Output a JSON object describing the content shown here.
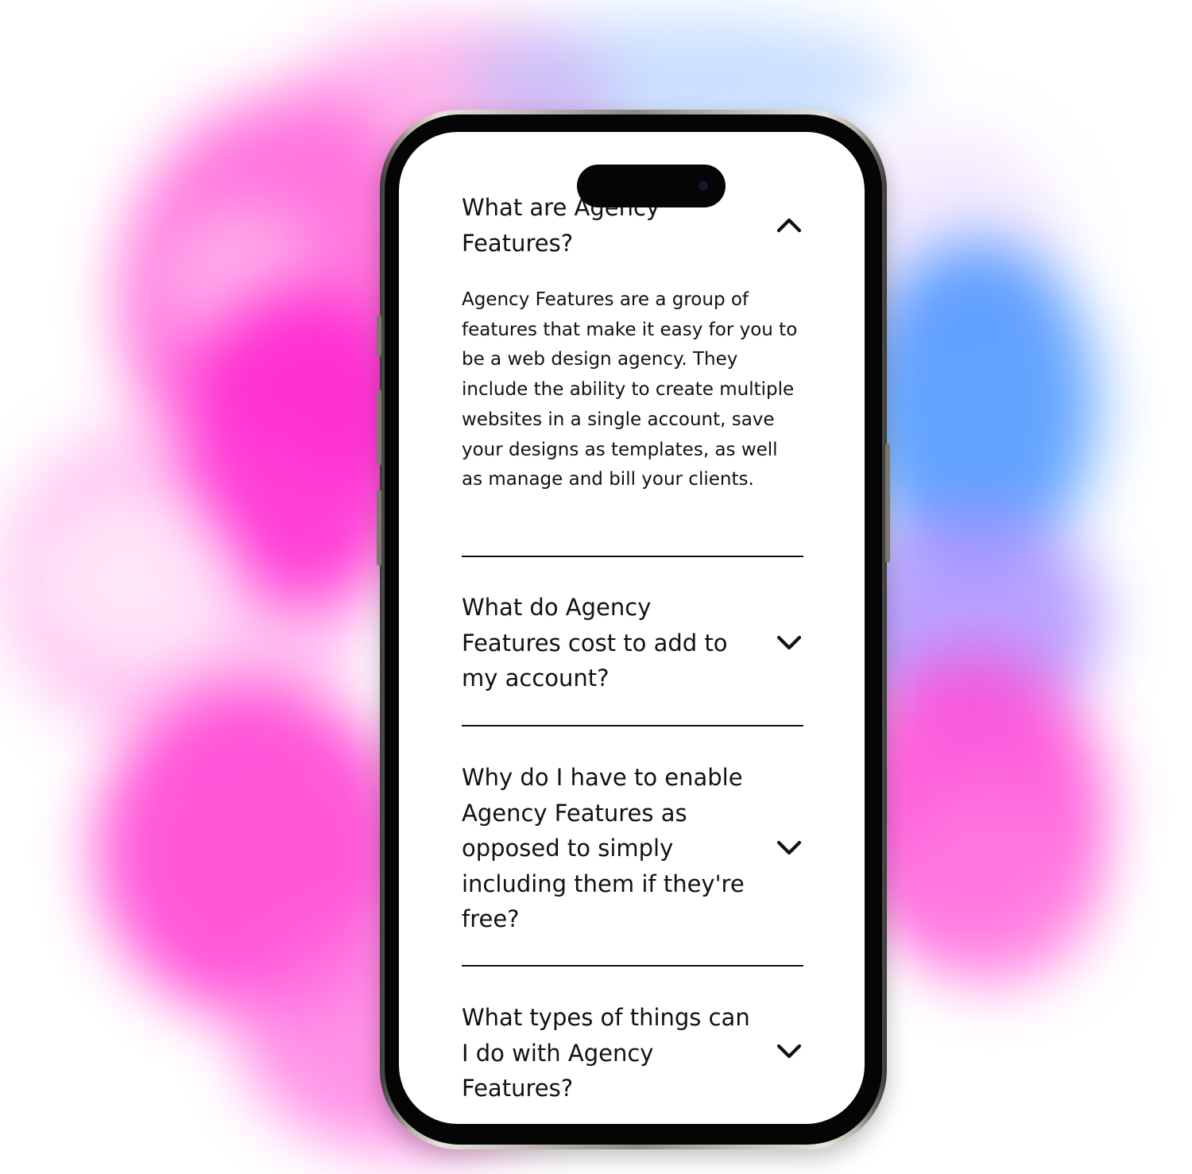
{
  "faq": {
    "items": [
      {
        "question": "What are Agency Features?",
        "expanded": true,
        "toggle_icon": "chevron-up-icon",
        "answer": "Agency Features are a group of features that make it easy for you to be a web design agency. They include the ability to create multiple websites in a single account, save your designs as templates, as well as manage and bill your clients."
      },
      {
        "question": "What do Agency Features cost to add to my account?",
        "expanded": false,
        "toggle_icon": "chevron-down-icon"
      },
      {
        "question": "Why do I have to enable Agency Features as opposed to simply including them if they're free?",
        "expanded": false,
        "toggle_icon": "chevron-down-icon"
      },
      {
        "question": "What types of things can I do with Agency Features?",
        "expanded": false,
        "toggle_icon": "chevron-down-icon"
      }
    ]
  },
  "colors": {
    "text": "#111111",
    "screen_background": "#ffffff",
    "divider": "#111111",
    "smoke_pink": "#ff1ecf",
    "smoke_blue": "#3c8dff"
  }
}
